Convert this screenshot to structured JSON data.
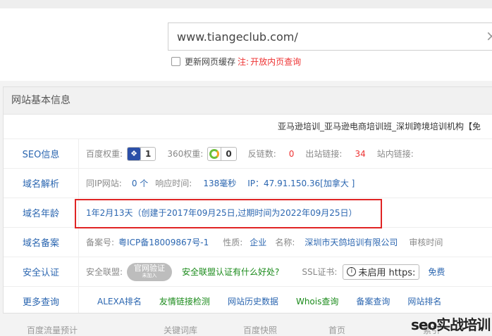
{
  "search": {
    "value": "www.tiangeclub.com/",
    "clear_icon": "×"
  },
  "options": {
    "refresh_cache": "更新网页缓存",
    "note_label": "注:",
    "note_text": "开放内页查询"
  },
  "panel": {
    "title": "网站基本信息",
    "site_title": "亚马逊培训_亚马逊电商培训班_深圳跨境培训机构【免",
    "rows": {
      "seo": {
        "label": "SEO信息",
        "baidu_label": "百度权重:",
        "baidu_value": "1",
        "w360_label": "360权重:",
        "w360_value": "0",
        "backlinks_label": "反链数:",
        "backlinks_value": "0",
        "outlinks_label": "出站链接:",
        "outlinks_value": "34",
        "inlinks_label": "站内链接:"
      },
      "dns": {
        "label": "域名解析",
        "sameip_label": "同IP网站:",
        "sameip_value": "0 个",
        "resp_label": "响应时间:",
        "resp_value": "138毫秒",
        "ip_text": "IP：47.91.150.36[加拿大 ]"
      },
      "age": {
        "label": "域名年龄",
        "value": "1年2月13天（创建于2017年09月25日,过期时间为2022年09月25日）"
      },
      "icp": {
        "label": "域名备案",
        "icp_label": "备案号:",
        "icp_value": "粤ICP备18009867号-1",
        "nature_label": "性质:",
        "nature_value": "企业",
        "name_label": "名称:",
        "name_value": "深圳市天鸽培训有限公司",
        "audit_label": "审核时间"
      },
      "security": {
        "label": "安全认证",
        "alliance_label": "安全联盟:",
        "seal_text": "官网验证",
        "seal_sub": "未加入",
        "alliance_link": "安全联盟认证有什么好处?",
        "ssl_label": "SSL证书:",
        "ssl_value": "未启用 https:",
        "free_text": "免费"
      },
      "more": {
        "label": "更多查询",
        "links": [
          "ALEXA排名",
          "友情链接检测",
          "网站历史数据",
          "Whois查询",
          "备案查询",
          "网站排名"
        ]
      }
    }
  },
  "bottom_tabs": [
    "百度流量预计",
    "关键词库",
    "百度快照",
    "首页",
    "索引"
  ],
  "watermark": "seo实战培训",
  "colors": {
    "link_blue": "#2b66b0",
    "alert_red": "#e33333",
    "green": "#1a8a1a",
    "highlight_box": "#e02424"
  }
}
